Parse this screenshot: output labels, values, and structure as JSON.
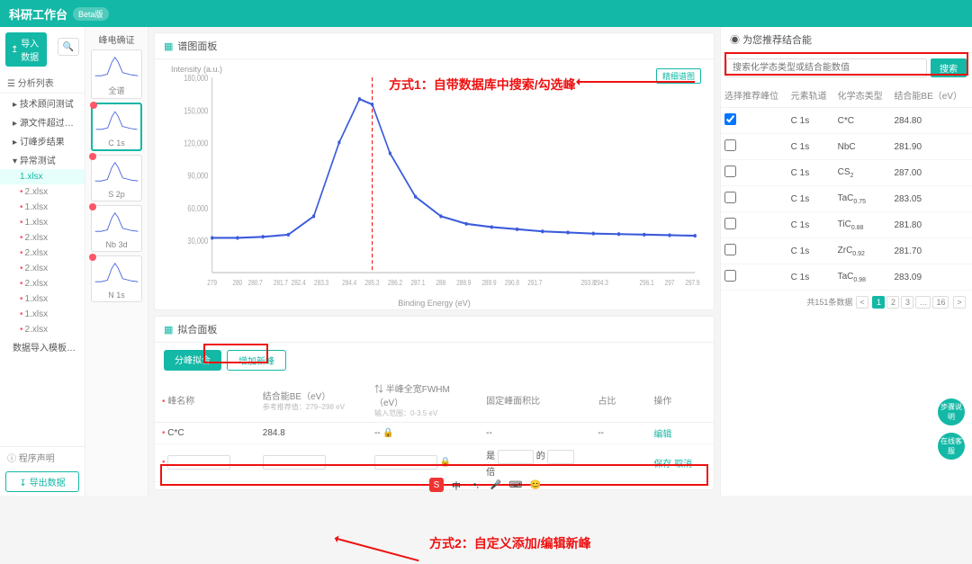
{
  "app": {
    "title": "科研工作台",
    "beta": "Beta版"
  },
  "left": {
    "import_btn": "导入数据",
    "tree_header": "分析列表",
    "nodes": [
      {
        "t": "技术顾问测试",
        "lvl": 1
      },
      {
        "t": "源文件超过1…",
        "lvl": 1
      },
      {
        "t": "订峰步结果",
        "lvl": 1
      },
      {
        "t": "异常测试",
        "lvl": 1,
        "open": true
      }
    ],
    "files": [
      "1.xlsx",
      "2.xlsx",
      "1.xlsx",
      "1.xlsx",
      "2.xlsx",
      "2.xlsx",
      "2.xlsx",
      "2.xlsx",
      "1.xlsx",
      "1.xlsx",
      "2.xlsx"
    ],
    "tpl": "数据导入模板 (…",
    "footer": "程序声明",
    "export_btn": "导出数据"
  },
  "thumbs": {
    "head": "峰电确证",
    "items": [
      {
        "cap": "全谱",
        "sel": false
      },
      {
        "cap": "C 1s",
        "sel": true
      },
      {
        "cap": "S 2p",
        "sel": false
      },
      {
        "cap": "Nb 3d",
        "sel": false
      },
      {
        "cap": "N 1s",
        "sel": false
      }
    ]
  },
  "chart": {
    "title": "谱图面板",
    "detail_btn": "精细谱图",
    "ylabel": "Intensity (a.u.)",
    "xlabel": "Binding Energy (eV)"
  },
  "chart_data": {
    "type": "line",
    "title": "C 1s",
    "xlabel": "Binding Energy (eV)",
    "ylabel": "Intensity (a.u.)",
    "xlim": [
      279,
      298
    ],
    "ylim": [
      0,
      180000
    ],
    "yticks": [
      30000,
      60000,
      90000,
      120000,
      150000,
      180000
    ],
    "xticks": [
      279,
      280,
      280.7,
      281.7,
      282.4,
      283.3,
      284.4,
      285.3,
      286.2,
      287.1,
      288,
      288.9,
      289.9,
      290.8,
      291.7,
      293.8,
      294.3,
      296.1,
      297,
      297.9
    ],
    "peak_marker_x": 285.3,
    "series": [
      {
        "name": "C 1s",
        "x": [
          279,
          280,
          281,
          282,
          283,
          284,
          284.8,
          285.3,
          286,
          287,
          288,
          289,
          290,
          291,
          292,
          293,
          294,
          295,
          296,
          297,
          298
        ],
        "y": [
          32000,
          32000,
          33000,
          35000,
          52000,
          120000,
          160000,
          155000,
          110000,
          70000,
          52000,
          45000,
          42000,
          40000,
          38000,
          37000,
          36000,
          35500,
          35000,
          34500,
          34000
        ]
      }
    ]
  },
  "anno": {
    "a1": "方式1：自带数据库中搜索/勾选峰",
    "a2": "方式2：自定义添加/编辑新峰"
  },
  "fit": {
    "title": "拟合面板",
    "tab1": "分峰拟合",
    "tab2": "增加新峰",
    "cols": {
      "name": "峰名称",
      "be": "结合能BE（eV）",
      "fwhm": "半峰全宽FWHM（eV）",
      "area": "固定峰面积比",
      "ratio": "占比",
      "op": "操作"
    },
    "hint_be": "参考推荐值：279–298 eV",
    "hint_fwhm": "输入范围：0-3.5 eV",
    "row1": {
      "name": "C*C",
      "be": "284.8",
      "fwhm": "--",
      "area": "--",
      "ratio": "--",
      "op": "编辑"
    },
    "row2": {
      "mid1": "是",
      "mid2": "的",
      "mid3": "倍",
      "save": "保存",
      "cancel": "取消"
    }
  },
  "right": {
    "title": "为您推荐结合能",
    "search_ph": "搜索化学态类型或结合能数值",
    "search_btn": "搜索",
    "cols": {
      "sel": "选择推荐峰位",
      "orb": "元素轨道",
      "chem": "化学态类型",
      "be": "结合能BE（eV）"
    },
    "rows": [
      {
        "sel": true,
        "orb": "C 1s",
        "chem": "C*C",
        "be": "284.80"
      },
      {
        "sel": false,
        "orb": "C 1s",
        "chem": "NbC",
        "be": "281.90"
      },
      {
        "sel": false,
        "orb": "C 1s",
        "chem": "CS2",
        "be": "287.00"
      },
      {
        "sel": false,
        "orb": "C 1s",
        "chem": "TaC0.75",
        "be": "283.05"
      },
      {
        "sel": false,
        "orb": "C 1s",
        "chem": "TiC0.88",
        "be": "281.80"
      },
      {
        "sel": false,
        "orb": "C 1s",
        "chem": "ZrC0.92",
        "be": "281.70"
      },
      {
        "sel": false,
        "orb": "C 1s",
        "chem": "TaC0.98",
        "be": "283.09"
      }
    ],
    "pager": {
      "total": "共151条数据",
      "pages": [
        "1",
        "2",
        "3",
        "…",
        "16"
      ],
      "next": ">"
    }
  },
  "float": {
    "b1": "步骤说明",
    "b2": "在线客服"
  }
}
